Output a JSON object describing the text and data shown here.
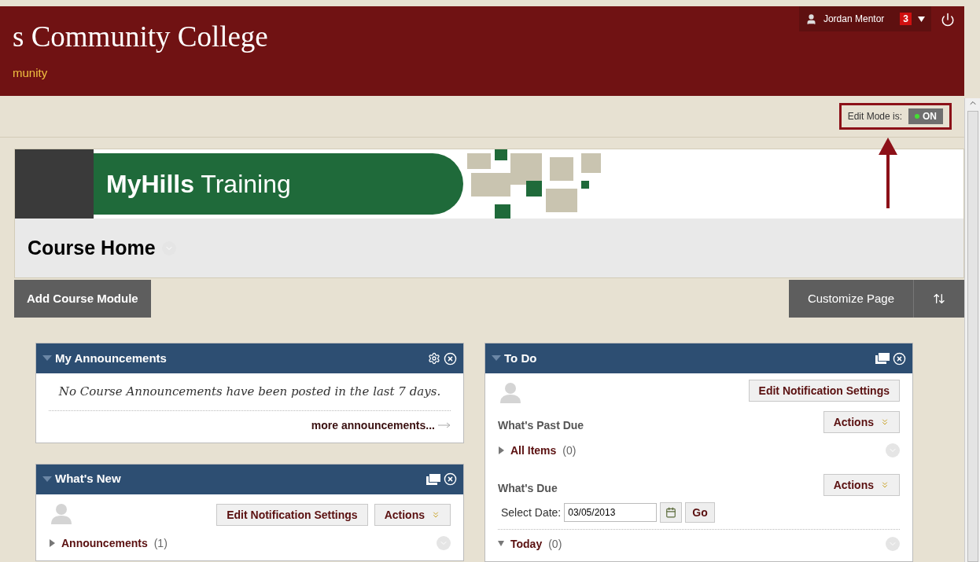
{
  "header": {
    "title": "s Community College",
    "subtitle": "munity",
    "user": "Jordan Mentor",
    "notifications": "3"
  },
  "edit_mode": {
    "label": "Edit Mode is:",
    "value": "ON",
    "on": true
  },
  "banner": {
    "title_bold": "MyHills",
    "title_rest": "Training"
  },
  "page_title": "Course Home",
  "toolbar": {
    "add": "Add Course Module",
    "customize": "Customize Page"
  },
  "columns": [
    [
      {
        "kind": "announcements",
        "title": "My Announcements",
        "message": "No Course Announcements have been posted in the last 7 days.",
        "link": "more announcements..."
      },
      {
        "kind": "whatsnew",
        "title": "What's New",
        "buttons": [
          "Edit Notification Settings",
          "Actions"
        ],
        "items": [
          {
            "label": "Announcements",
            "count": "(1)",
            "expanded": false
          }
        ]
      }
    ],
    [
      {
        "kind": "todo",
        "title": "To Do",
        "settings_button": "Edit Notification Settings",
        "sections": [
          {
            "heading": "What's Past Due",
            "actions": "Actions",
            "items": [
              {
                "label": "All Items",
                "count": "(0)",
                "expanded": false
              }
            ]
          },
          {
            "heading": "What's Due",
            "actions": "Actions",
            "date_label": "Select Date:",
            "date_value": "03/05/2013",
            "go": "Go",
            "items": [
              {
                "label": "Today",
                "count": "(0)",
                "expanded": true
              }
            ]
          }
        ]
      }
    ]
  ]
}
